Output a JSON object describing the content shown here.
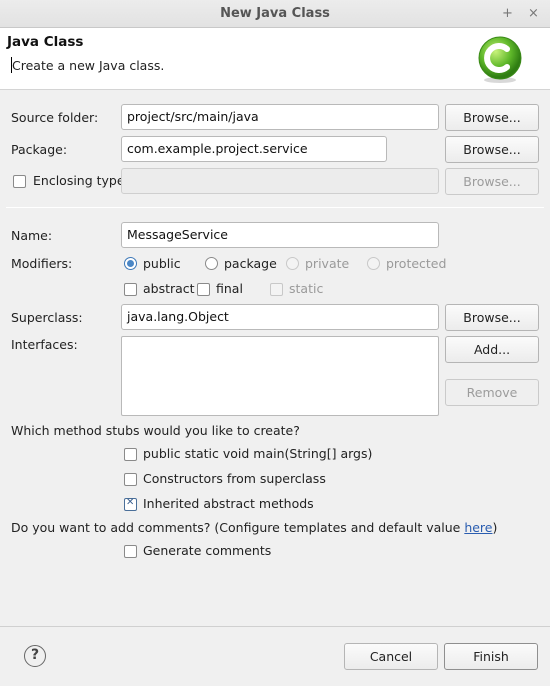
{
  "window": {
    "title": "New Java Class",
    "pin_icon": "+",
    "close_icon": "×"
  },
  "header": {
    "title": "Java Class",
    "description": "Create a new Java class."
  },
  "source_folder": {
    "label": "Source folder:",
    "value": "project/src/main/java",
    "browse": "Browse..."
  },
  "package": {
    "label": "Package:",
    "value": "com.example.project.service",
    "browse": "Browse..."
  },
  "enclosing_type": {
    "label": "Enclosing type:",
    "value": "",
    "browse": "Browse..."
  },
  "name": {
    "label": "Name:",
    "value": "MessageService"
  },
  "modifiers": {
    "label": "Modifiers:",
    "public": "public",
    "package": "package",
    "private": "private",
    "protected": "protected",
    "abstract": "abstract",
    "final": "final",
    "static": "static"
  },
  "superclass": {
    "label": "Superclass:",
    "value": "java.lang.Object",
    "browse": "Browse..."
  },
  "interfaces": {
    "label": "Interfaces:",
    "add": "Add...",
    "remove": "Remove"
  },
  "stubs": {
    "question": "Which method stubs would you like to create?",
    "main": "public static void main(String[] args)",
    "constructors": "Constructors from superclass",
    "inherited": "Inherited abstract methods"
  },
  "comments": {
    "question": "Do you want to add comments? (Configure templates and default value ",
    "link": "here",
    "close_paren": ")",
    "generate": "Generate comments"
  },
  "footer": {
    "help": "?",
    "cancel": "Cancel",
    "finish": "Finish"
  }
}
